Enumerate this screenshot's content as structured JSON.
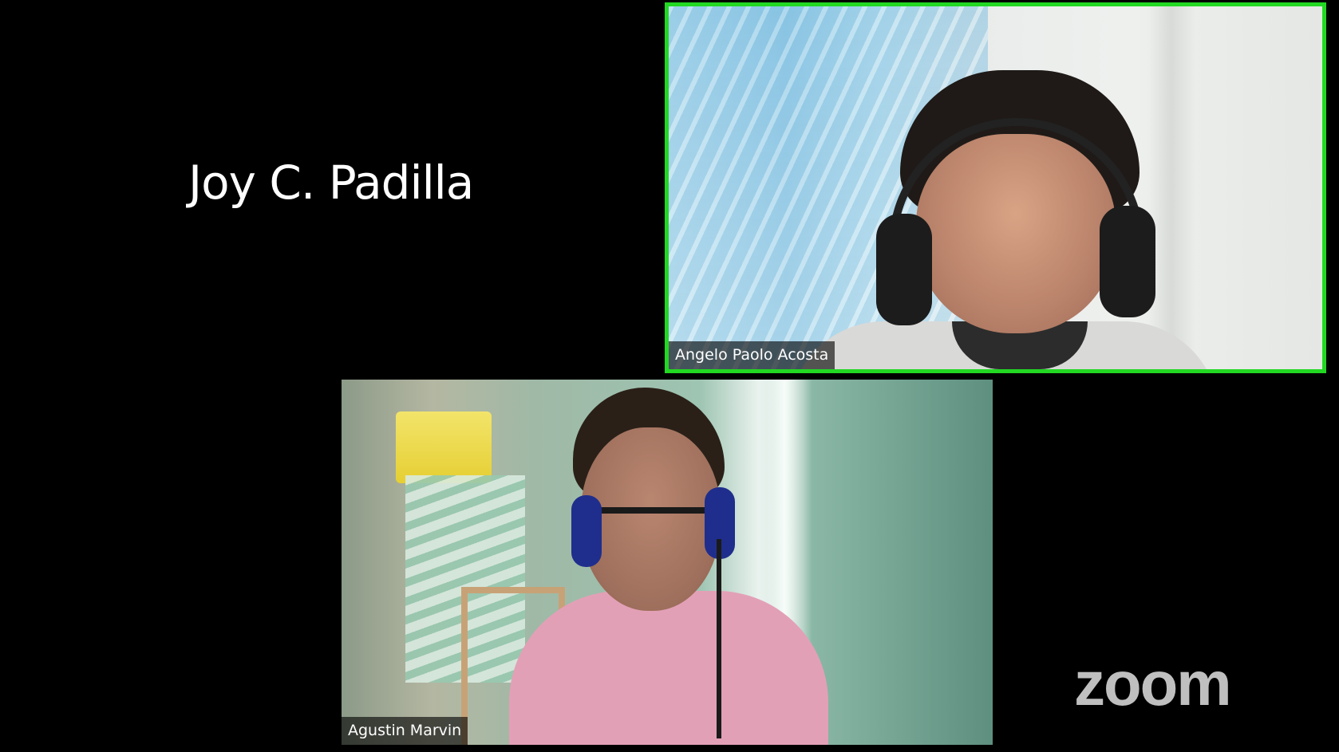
{
  "participants": [
    {
      "name": "Joy C. Padilla",
      "video": "off"
    },
    {
      "name": "Angelo Paolo Acosta",
      "video": "on",
      "active_speaker": true
    },
    {
      "name": "Agustin Marvin",
      "video": "on"
    }
  ],
  "branding": {
    "watermark": "zoom"
  },
  "colors": {
    "active_speaker_border": "#22d822",
    "background": "#000000",
    "watermark": "#bfbfbf"
  }
}
